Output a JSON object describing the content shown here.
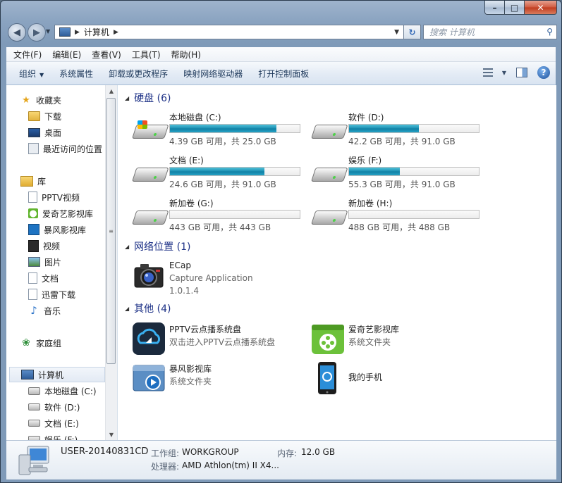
{
  "window": {
    "controls": {
      "minimize": "–",
      "maximize": "□",
      "close": "✕"
    }
  },
  "address": {
    "crumb": "计算机",
    "search_placeholder": "搜索 计算机"
  },
  "menu": [
    "文件(F)",
    "编辑(E)",
    "查看(V)",
    "工具(T)",
    "帮助(H)"
  ],
  "commands": {
    "organize": "组织",
    "system_props": "系统属性",
    "uninstall": "卸载或更改程序",
    "map_drive": "映射网络驱动器",
    "control_panel": "打开控制面板"
  },
  "nav": {
    "favorites": "收藏夹",
    "fav_items": [
      "下载",
      "桌面",
      "最近访问的位置"
    ],
    "libraries": "库",
    "lib_items": [
      "PPTV视频",
      "爱奇艺影视库",
      "暴风影视库",
      "视频",
      "图片",
      "文档",
      "迅雷下载",
      "音乐"
    ],
    "homegroup": "家庭组",
    "computer": "计算机",
    "computer_items": [
      "本地磁盘 (C:)",
      "软件 (D:)",
      "文档 (E:)",
      "娱乐 (F:)"
    ]
  },
  "groups": {
    "hdd": "硬盘 (6)",
    "network": "网络位置 (1)",
    "other": "其他 (4)"
  },
  "drives": [
    {
      "name": "本地磁盘 (C:)",
      "usage": "4.39 GB 可用，共 25.0 GB",
      "used_fraction": 0.82,
      "system": true
    },
    {
      "name": "软件 (D:)",
      "usage": "42.2 GB 可用，共 91.0 GB",
      "used_fraction": 0.54
    },
    {
      "name": "文档 (E:)",
      "usage": "24.6 GB 可用，共 91.0 GB",
      "used_fraction": 0.73
    },
    {
      "name": "娱乐 (F:)",
      "usage": "55.3 GB 可用，共 91.0 GB",
      "used_fraction": 0.39
    },
    {
      "name": "新加卷 (G:)",
      "usage": "443 GB 可用，共 443 GB",
      "used_fraction": 0.0
    },
    {
      "name": "新加卷 (H:)",
      "usage": "488 GB 可用，共 488 GB",
      "used_fraction": 0.0
    }
  ],
  "network": {
    "name": "ECap",
    "desc": "Capture Application",
    "version": "1.0.1.4"
  },
  "others": [
    {
      "name": "PPTV云点播系统盘",
      "desc": "双击进入PPTV云点播系统盘"
    },
    {
      "name": "爱奇艺影视库",
      "desc": "系统文件夹"
    },
    {
      "name": "暴风影视库",
      "desc": "系统文件夹"
    },
    {
      "name": "我的手机",
      "desc": ""
    }
  ],
  "details": {
    "computer_name": "USER-20140831CD",
    "workgroup_label": "工作组:",
    "workgroup": "WORKGROUP",
    "memory_label": "内存:",
    "memory": "12.0 GB",
    "cpu_label": "处理器:",
    "cpu": "AMD Athlon(tm) II X4..."
  },
  "colors": {
    "group_header": "#1e3287",
    "bar_fill": "#1b8eb1"
  },
  "icons": {
    "back": "back-arrow-icon",
    "forward": "forward-arrow-icon",
    "refresh": "refresh-icon",
    "search": "search-icon",
    "views": "views-icon",
    "preview": "preview-pane-icon",
    "help": "help-icon"
  }
}
